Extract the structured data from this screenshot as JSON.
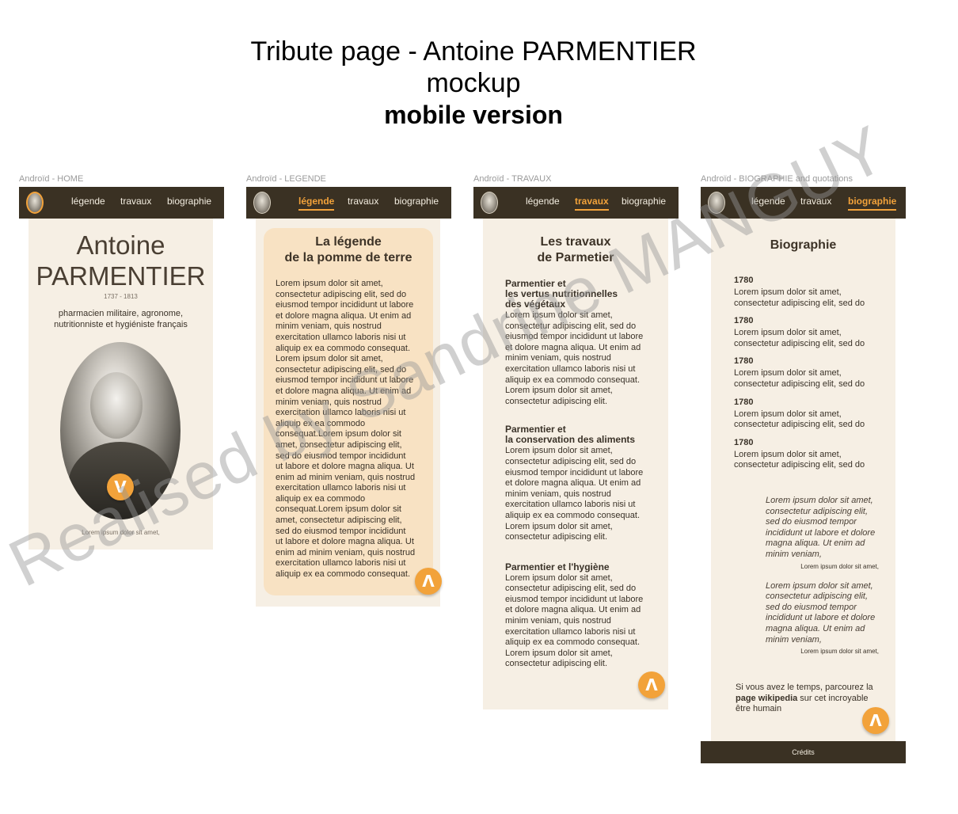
{
  "page": {
    "title_line1": "Tribute page - Antoine PARMENTIER",
    "title_line2": "mockup",
    "title_line3": "mobile version",
    "watermark": "Realised by Sandrine MANGUY"
  },
  "nav": {
    "legende": "légende",
    "travaux": "travaux",
    "biographie": "biographie",
    "avatar_icon": "parmentier-portrait-icon"
  },
  "colors": {
    "navbar": "#3a3123",
    "accent": "#f2a23a",
    "panel": "#f6efe4",
    "card": "#f8e2c3"
  },
  "frames": {
    "home": {
      "label": "Androïd - HOME",
      "name_line1": "Antoine",
      "name_line2": "PARMENTIER",
      "dates": "1737 - 1813",
      "subtitle": "pharmacien militaire, agronome, nutritionniste et hygiéniste français",
      "down_button": "V",
      "footer_text": "Lorem ipsum dolor sit amet,"
    },
    "legende": {
      "label": "Androïd - LEGENDE",
      "heading_line1": "La légende",
      "heading_line2": "de la pomme de terre",
      "lines": [
        "Lorem ipsum dolor sit amet,",
        "consectetur adipiscing elit, sed do",
        "eiusmod tempor incididunt ut labore",
        "et dolore magna aliqua. Ut enim ad",
        "minim veniam, quis nostrud",
        "exercitation ullamco laboris nisi ut",
        "aliquip ex ea commodo consequat.",
        "Lorem ipsum dolor sit amet,",
        "consectetur adipiscing elit, sed do",
        "eiusmod tempor incididunt ut labore",
        "et dolore magna aliqua. Ut enim ad",
        "minim veniam, quis nostrud",
        "exercitation ullamco laboris nisi ut",
        "aliquip ex ea commodo",
        "consequat.Lorem ipsum dolor sit",
        "amet, consectetur adipiscing elit,",
        "sed do eiusmod tempor incididunt",
        "ut labore et dolore magna aliqua. Ut",
        "enim ad minim veniam, quis nostrud",
        "exercitation ullamco laboris nisi ut",
        "aliquip ex ea commodo",
        "consequat.Lorem ipsum dolor sit",
        "amet, consectetur adipiscing elit,",
        "sed do eiusmod tempor incididunt",
        "ut labore et dolore magna aliqua. Ut",
        "enim ad minim veniam, quis nostrud",
        "exercitation ullamco laboris nisi ut",
        "aliquip ex ea commodo consequat."
      ],
      "up_button": "Λ"
    },
    "travaux": {
      "label": "Androïd - TRAVAUX",
      "heading_line1": "Les travaux",
      "heading_line2": "de Parmetier",
      "sections": [
        {
          "title_lines": [
            "Parmentier et",
            "les vertus nutritionnelles",
            "des végétaux"
          ],
          "lines": [
            "Lorem ipsum dolor sit amet,",
            "consectetur adipiscing elit, sed do",
            "eiusmod tempor incididunt ut labore",
            "et dolore magna aliqua. Ut enim ad",
            "minim veniam, quis nostrud",
            "exercitation ullamco laboris nisi ut",
            "aliquip ex ea commodo consequat.",
            "Lorem ipsum dolor sit amet,",
            "consectetur adipiscing elit."
          ]
        },
        {
          "title_lines": [
            "Parmentier et",
            "la conservation des aliments"
          ],
          "lines": [
            "Lorem ipsum dolor sit amet,",
            "consectetur adipiscing elit, sed do",
            "eiusmod tempor incididunt ut labore",
            "et dolore magna aliqua. Ut enim ad",
            "minim veniam, quis nostrud",
            "exercitation ullamco laboris nisi ut",
            "aliquip ex ea commodo consequat.",
            "Lorem ipsum dolor sit amet,",
            "consectetur adipiscing elit."
          ]
        },
        {
          "title_lines": [
            "Parmentier et l'hygiène"
          ],
          "lines": [
            "Lorem ipsum dolor sit amet,",
            "consectetur adipiscing elit, sed do",
            "eiusmod tempor incididunt ut labore",
            "et dolore magna aliqua. Ut enim ad",
            "minim veniam, quis nostrud",
            "exercitation ullamco laboris nisi ut",
            "aliquip ex ea commodo consequat.",
            "Lorem ipsum dolor sit amet,",
            "consectetur adipiscing elit."
          ]
        }
      ],
      "up_button": "Λ"
    },
    "biographie": {
      "label": "Androïd - BIOGRAPHIE and quotations",
      "heading": "Biographie",
      "entries": [
        {
          "year": "1780",
          "line1": "Lorem ipsum dolor sit amet,",
          "line2": "consectetur adipiscing elit, sed do"
        },
        {
          "year": "1780",
          "line1": "Lorem ipsum dolor sit amet,",
          "line2": "consectetur adipiscing elit, sed do"
        },
        {
          "year": "1780",
          "line1": "Lorem ipsum dolor sit amet,",
          "line2": "consectetur adipiscing elit, sed do"
        },
        {
          "year": "1780",
          "line1": "Lorem ipsum dolor sit amet,",
          "line2": "consectetur adipiscing elit, sed do"
        },
        {
          "year": "1780",
          "line1": "Lorem ipsum dolor sit amet,",
          "line2": "consectetur adipiscing elit, sed do"
        }
      ],
      "quotes": [
        {
          "lines": [
            "Lorem ipsum dolor sit amet,",
            "consectetur adipiscing elit,",
            "sed do eiusmod tempor",
            "incididunt ut labore et dolore",
            "magna aliqua. Ut enim ad",
            "minim veniam,"
          ],
          "author": "Lorem ipsum dolor sit amet,"
        },
        {
          "lines": [
            "Lorem ipsum dolor sit amet,",
            "consectetur adipiscing elit,",
            "sed do eiusmod tempor",
            "incididunt ut labore et dolore",
            "magna aliqua. Ut enim ad",
            "minim veniam,"
          ],
          "author": "Lorem ipsum dolor sit amet,"
        }
      ],
      "wiki_line1": "Si vous avez le temps, parcourez la",
      "wiki_link": "page wikipedia",
      "wiki_line2_rest": " sur cet incroyable",
      "wiki_line3": "être humain",
      "up_button": "Λ",
      "footer": "Crédits"
    }
  }
}
